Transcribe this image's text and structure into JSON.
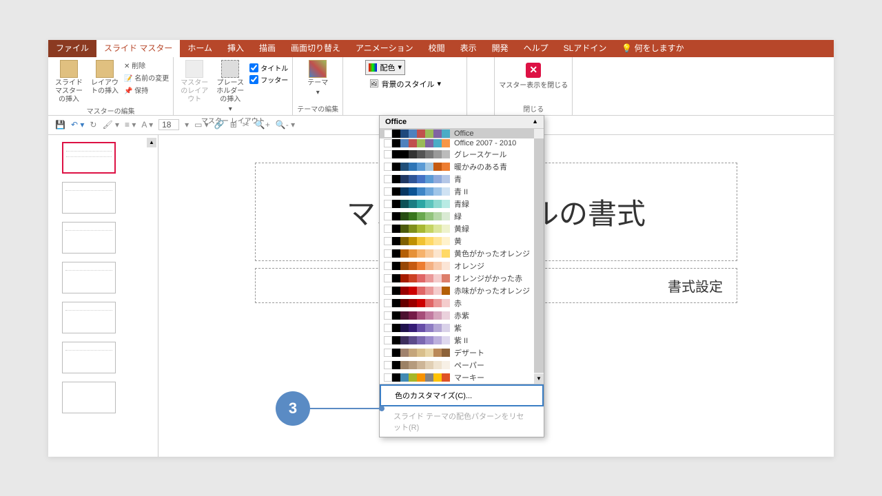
{
  "tabs": {
    "file": "ファイル",
    "slideMaster": "スライド マスター",
    "home": "ホーム",
    "insert": "挿入",
    "draw": "描画",
    "transition": "画面切り替え",
    "animation": "アニメーション",
    "review": "校閲",
    "view": "表示",
    "dev": "開発",
    "help": "ヘルプ",
    "sladdin": "SLアドイン",
    "tell": "何をしますか"
  },
  "ribbon": {
    "insertMaster": "スライド マスターの挿入",
    "insertLayout": "レイアウトの挿入",
    "delete": "削除",
    "rename": "名前の変更",
    "preserve": "保持",
    "editMasterGroup": "マスターの編集",
    "masterLayout": "マスターのレイアウト",
    "placeholder": "プレースホルダーの挿入",
    "title": "タイトル",
    "footer": "フッター",
    "masterLayoutGroup": "マスター レイアウト",
    "theme": "テーマ",
    "colors": "配色",
    "bgStyles": "背景のスタイル",
    "editThemeGroup": "テーマの編集",
    "closeMaster": "マスター表示を閉じる",
    "closeGroup": "閉じる"
  },
  "fontSize": "18",
  "dropdown": {
    "header": "Office",
    "customize": "色のカスタマイズ(C)...",
    "reset": "スライド テーマの配色パターンをリセット(R)",
    "themes": [
      {
        "name": "Office",
        "sel": true,
        "c": [
          "#1f497d",
          "#4f81bd",
          "#c0504d",
          "#9bbb59",
          "#8064a2",
          "#4bacc6",
          "#f79646",
          "#ffc000"
        ]
      },
      {
        "name": "Office 2007 - 2010",
        "c": [
          "#4f81bd",
          "#c0504d",
          "#9bbb59",
          "#8064a2",
          "#4bacc6",
          "#f79646",
          "#1f497d",
          "#938953"
        ]
      },
      {
        "name": "グレースケール",
        "c": [
          "#000",
          "#333",
          "#555",
          "#777",
          "#999",
          "#bbb",
          "#ddd",
          "#eee"
        ]
      },
      {
        "name": "暖かみのある青",
        "c": [
          "#1f4e79",
          "#2e75b6",
          "#5b9bd5",
          "#a5c8e1",
          "#c55a11",
          "#ed7d31",
          "#ffc000",
          "#70ad47"
        ]
      },
      {
        "name": "青",
        "c": [
          "#1f3864",
          "#2f5597",
          "#4472c4",
          "#5b9bd5",
          "#8faadc",
          "#b4c7e7",
          "#44546a",
          "#d6dce5"
        ]
      },
      {
        "name": "青 II",
        "c": [
          "#073763",
          "#0b5394",
          "#3d85c6",
          "#6fa8dc",
          "#9fc5e8",
          "#cfe2f3",
          "#44546a",
          "#a5b8d0"
        ]
      },
      {
        "name": "青緑",
        "c": [
          "#0d5257",
          "#1b7d82",
          "#2ca6a4",
          "#5cc4bd",
          "#8dd9d0",
          "#b8ebe4",
          "#44546a",
          "#a5b8d0"
        ]
      },
      {
        "name": "緑",
        "c": [
          "#274e13",
          "#38761d",
          "#6aa84f",
          "#93c47d",
          "#b6d7a8",
          "#d9ead3",
          "#44546a",
          "#a5b8d0"
        ]
      },
      {
        "name": "黄緑",
        "c": [
          "#4c5b0c",
          "#7f8f1c",
          "#a8b833",
          "#c5d463",
          "#dce69a",
          "#eef2cc",
          "#bf9000",
          "#f1c232"
        ]
      },
      {
        "name": "黄",
        "c": [
          "#7f6000",
          "#bf9000",
          "#f1c232",
          "#ffd966",
          "#ffe599",
          "#fff2cc",
          "#b45f06",
          "#e69138"
        ]
      },
      {
        "name": "黄色がかったオレンジ",
        "c": [
          "#b45f06",
          "#e69138",
          "#f6b26b",
          "#f9cb9c",
          "#fce5cd",
          "#ffd966",
          "#7f6000",
          "#bf9000"
        ]
      },
      {
        "name": "オレンジ",
        "c": [
          "#974706",
          "#c55a11",
          "#ed7d31",
          "#f4b183",
          "#f8cbad",
          "#fbe5d6",
          "#833c0c",
          "#c55a11"
        ]
      },
      {
        "name": "オレンジがかった赤",
        "c": [
          "#a61c00",
          "#cc4125",
          "#e06666",
          "#ea9999",
          "#f4cccc",
          "#dd7e6b",
          "#660000",
          "#990000"
        ]
      },
      {
        "name": "赤味がかったオレンジ",
        "c": [
          "#990000",
          "#cc0000",
          "#e06666",
          "#ea9999",
          "#f4cccc",
          "#b45f06",
          "#e69138",
          "#f6b26b"
        ]
      },
      {
        "name": "赤",
        "c": [
          "#660000",
          "#990000",
          "#cc0000",
          "#e06666",
          "#ea9999",
          "#f4cccc",
          "#741b47",
          "#a64d79"
        ]
      },
      {
        "name": "赤紫",
        "c": [
          "#4c1130",
          "#741b47",
          "#a64d79",
          "#c27ba0",
          "#d5a6bd",
          "#ead1dc",
          "#660000",
          "#990000"
        ]
      },
      {
        "name": "紫",
        "c": [
          "#20124d",
          "#351c75",
          "#674ea7",
          "#8e7cc3",
          "#b4a7d6",
          "#d9d2e9",
          "#741b47",
          "#a64d79"
        ]
      },
      {
        "name": "紫 II",
        "c": [
          "#3d2e5c",
          "#5c4b8a",
          "#7b68b0",
          "#9b8acc",
          "#bcb0dd",
          "#ded8ee",
          "#44546a",
          "#a5b8d0"
        ]
      },
      {
        "name": "デザート",
        "c": [
          "#a0826d",
          "#c4a57b",
          "#d9bf8c",
          "#e8d5a8",
          "#ba8958",
          "#8c6239",
          "#6b4423",
          "#4a2c0f"
        ]
      },
      {
        "name": "ペーパー",
        "c": [
          "#9c8265",
          "#b59b7d",
          "#cdb597",
          "#e1cfb4",
          "#efe3d0",
          "#f7f0e6",
          "#7a6349",
          "#5c4a35"
        ]
      },
      {
        "name": "マーキー",
        "c": [
          "#418ab3",
          "#a6b727",
          "#f69200",
          "#838383",
          "#fec306",
          "#df5327",
          "#44546a",
          "#a5b8d0"
        ]
      }
    ]
  },
  "slide": {
    "title_left": "マスタ",
    "title_right": "ルの書式",
    "subtitle": "書式設定"
  },
  "callout": "3"
}
